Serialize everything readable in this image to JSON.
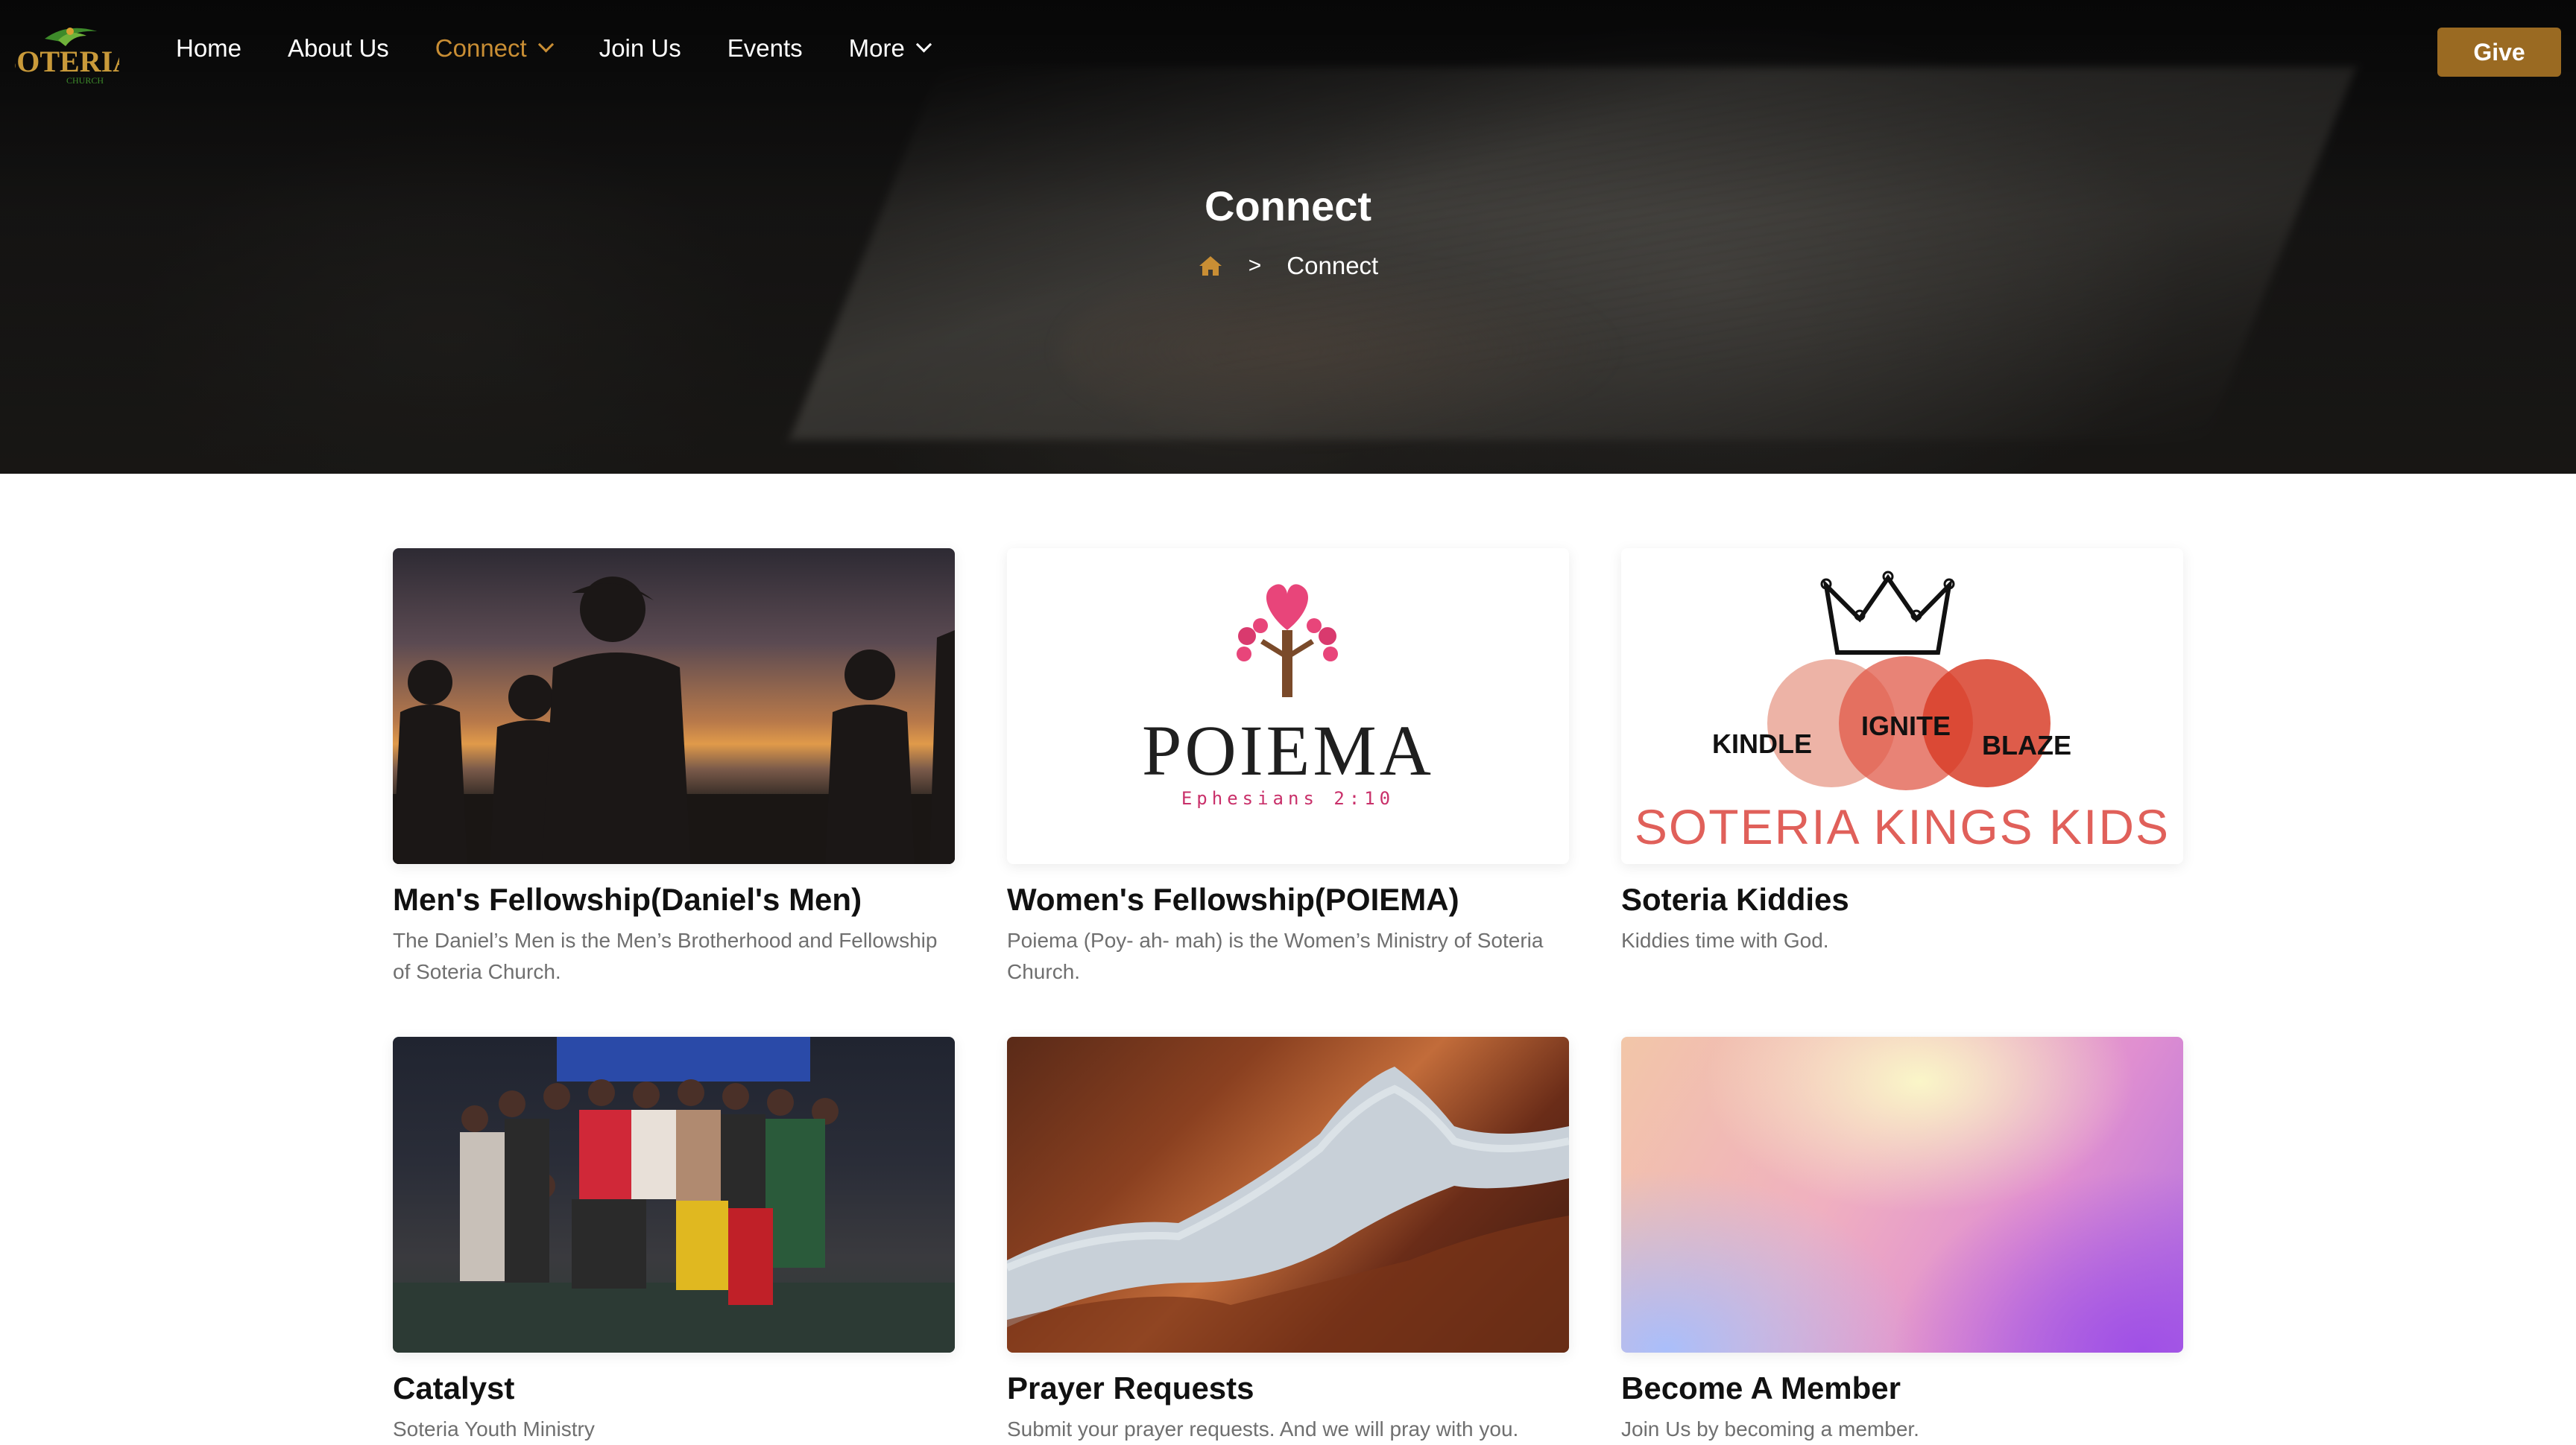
{
  "brand": {
    "logo_text": "SOTERIA",
    "logo_subtext": "CHURCH"
  },
  "nav": {
    "items": [
      {
        "label": "Home"
      },
      {
        "label": "About Us"
      },
      {
        "label": "Connect"
      },
      {
        "label": "Join Us"
      },
      {
        "label": "Events"
      },
      {
        "label": "More"
      }
    ],
    "give_label": "Give"
  },
  "hero": {
    "title": "Connect",
    "breadcrumb": {
      "separator": ">",
      "current": "Connect"
    }
  },
  "cards": [
    {
      "title": "Men's Fellowship(Daniel's Men)",
      "description": "The Daniel’s Men is the Men’s Brotherhood and Fellowship of Soteria Church."
    },
    {
      "title": "Women's Fellowship(POIEMA)",
      "description": "Poiema (Poy- ah- mah) is the Women’s Ministry of Soteria Church.",
      "image_text": {
        "word": "POIEMA",
        "verse": "Ephesians 2:10"
      }
    },
    {
      "title": "Soteria Kiddies",
      "description": "Kiddies time with God.",
      "image_text": {
        "kindle": "KINDLE",
        "ignite": "IGNITE",
        "blaze": "BLAZE",
        "brand": "SOTERIA KINGS KIDS"
      }
    },
    {
      "title": "Catalyst",
      "description": "Soteria Youth Ministry"
    },
    {
      "title": "Prayer Requests",
      "description": "Submit your prayer requests. And we will pray with you."
    },
    {
      "title": "Become A Member",
      "description": "Join Us by becoming a member."
    }
  ],
  "colors": {
    "accent": "#c98e34",
    "give_bg": "#9a6a22",
    "text_dark": "#111111",
    "text_muted": "#6f6f6f"
  }
}
